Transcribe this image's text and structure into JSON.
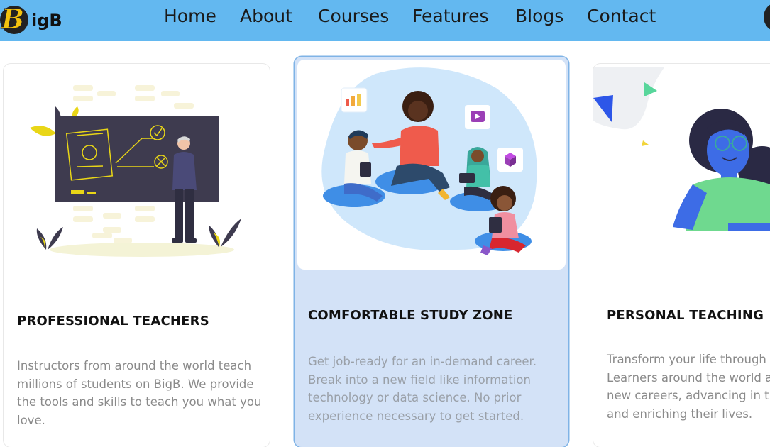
{
  "header": {
    "logo_letter": "B",
    "logo_text": "igB",
    "nav": [
      "Home",
      "About",
      "Courses",
      "Features",
      "Blogs",
      "Contact"
    ]
  },
  "cards": [
    {
      "title": "PROFESSIONAL TEACHERS",
      "lines": [
        "Instructors from around the world teach",
        "millions of students on BigB. We provide",
        "the tools and skills to teach you what you",
        "love."
      ]
    },
    {
      "title": "COMFORTABLE STUDY ZONE",
      "lines": [
        "Get job-ready for an in-demand career.",
        "Break into a new field like information",
        "technology or data science. No prior",
        "experience necessary to get started."
      ]
    },
    {
      "title": "PERSONAL TEACHING",
      "lines": [
        "Transform your life through e",
        "Learners around the world ar",
        "new careers, advancing in th",
        "and enriching their lives."
      ]
    }
  ],
  "colors": {
    "header_bg": "#63b8f0",
    "active_card_bg": "#d3e2f7",
    "logo_yellow": "#f3c20d"
  }
}
